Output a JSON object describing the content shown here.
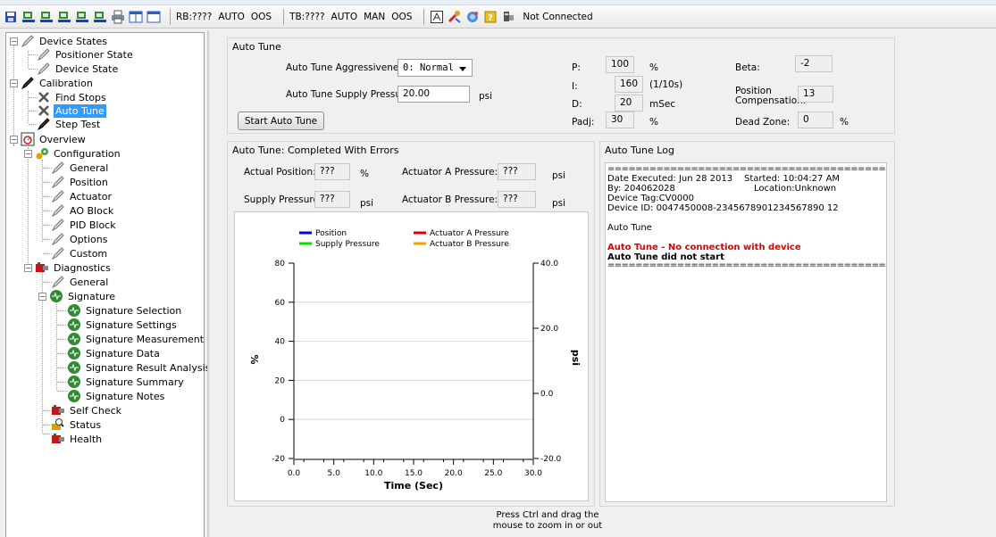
{
  "toolbar": {
    "rb_status": "RB:????",
    "rb_auto": "AUTO",
    "rb_oos": "OOS",
    "tb_status": "TB:????",
    "tb_auto": "AUTO",
    "tb_man": "MAN",
    "tb_oos": "OOS",
    "connection": "Not Connected"
  },
  "tree": {
    "device_states": "Device States",
    "positioner_state": "Positioner State",
    "device_state": "Device State",
    "calibration": "Calibration",
    "find_stops": "Find Stops",
    "auto_tune": "Auto Tune",
    "step_test": "Step Test",
    "overview": "Overview",
    "configuration": "Configuration",
    "general": "General",
    "position": "Position",
    "actuator": "Actuator",
    "ao_block": "AO Block",
    "pid_block": "PID Block",
    "options": "Options",
    "custom": "Custom",
    "diagnostics": "Diagnostics",
    "diag_general": "General",
    "signature": "Signature",
    "sig_selection": "Signature Selection",
    "sig_settings": "Signature Settings",
    "sig_measurement": "Signature Measurement",
    "sig_data": "Signature Data",
    "sig_result": "Signature Result Analysis",
    "sig_summary": "Signature Summary",
    "sig_notes": "Signature Notes",
    "self_check": "Self Check",
    "status": "Status",
    "health": "Health"
  },
  "autotune": {
    "group_title": "Auto Tune",
    "aggressiveness_label": "Auto Tune Aggressiveness:",
    "aggressiveness_value": "0: Normal",
    "supply_label": "Auto Tune Supply Pressure:",
    "supply_value": "20.00",
    "supply_unit": "psi",
    "start_button": "Start Auto Tune",
    "p_label": "P:",
    "p_value": "100",
    "p_unit": "%",
    "i_label": "I:",
    "i_value": "160",
    "i_unit": "(1/10s)",
    "d_label": "D:",
    "d_value": "20",
    "d_unit": "mSec",
    "padj_label": "Padj:",
    "padj_value": "30",
    "padj_unit": "%",
    "beta_label": "Beta:",
    "beta_value": "-2",
    "poscomp_label_1": "Position",
    "poscomp_label_2": "Compensation:",
    "poscomp_value": "13",
    "deadzone_label": "Dead Zone:",
    "deadzone_value": "0",
    "deadzone_unit": "%"
  },
  "results": {
    "group_title": "Auto Tune: Completed With Errors",
    "actual_position_label": "Actual Position:",
    "actual_position_value": "???",
    "actual_position_unit": "%",
    "supply_pressure_label": "Supply Pressure:",
    "supply_pressure_value": "???",
    "supply_pressure_unit": "psi",
    "act_a_label": "Actuator A Pressure:",
    "act_a_value": "???",
    "act_a_unit": "psi",
    "act_b_label": "Actuator B Pressure:",
    "act_b_value": "???",
    "act_b_unit": "psi"
  },
  "chart_data": {
    "type": "line",
    "title": "",
    "xlabel": "Time (Sec)",
    "ylabel": "%",
    "y2label": "psi",
    "xlim": [
      0,
      30
    ],
    "ylim": [
      -20,
      80
    ],
    "y2lim": [
      -20,
      40
    ],
    "x_ticks": [
      "0.0",
      "5.0",
      "10.0",
      "15.0",
      "20.0",
      "25.0",
      "30.0"
    ],
    "y_ticks": [
      "-20",
      "0",
      "20",
      "40",
      "60",
      "80"
    ],
    "y2_ticks": [
      "-20.0",
      "0.0",
      "20.0",
      "40.0"
    ],
    "grid": true,
    "legend_position": "top",
    "series": [
      {
        "name": "Position",
        "color": "#0000e0",
        "values": []
      },
      {
        "name": "Supply Pressure",
        "color": "#00e000",
        "values": []
      },
      {
        "name": "Actuator A Pressure",
        "color": "#e00000",
        "values": []
      },
      {
        "name": "Actuator B Pressure",
        "color": "#f0a000",
        "values": []
      }
    ]
  },
  "log": {
    "title": "Auto Tune Log",
    "separator": "==========================================",
    "date_executed": "Date Executed: Jun 28 2013",
    "started": "Started: 10:04:27 AM",
    "by": "By: 204062028",
    "location": "Location:Unknown",
    "device_tag": "Device Tag:CV0000",
    "device_id": "Device ID: 0047450008-2345678901234567890 12",
    "heading": "Auto Tune",
    "error": "Auto Tune - No connection with device",
    "not_started": "Auto Tune did not start",
    "separator2": "=========================================="
  },
  "hint": {
    "line1": "Press Ctrl and drag the",
    "line2": "mouse to zoom in or out"
  }
}
